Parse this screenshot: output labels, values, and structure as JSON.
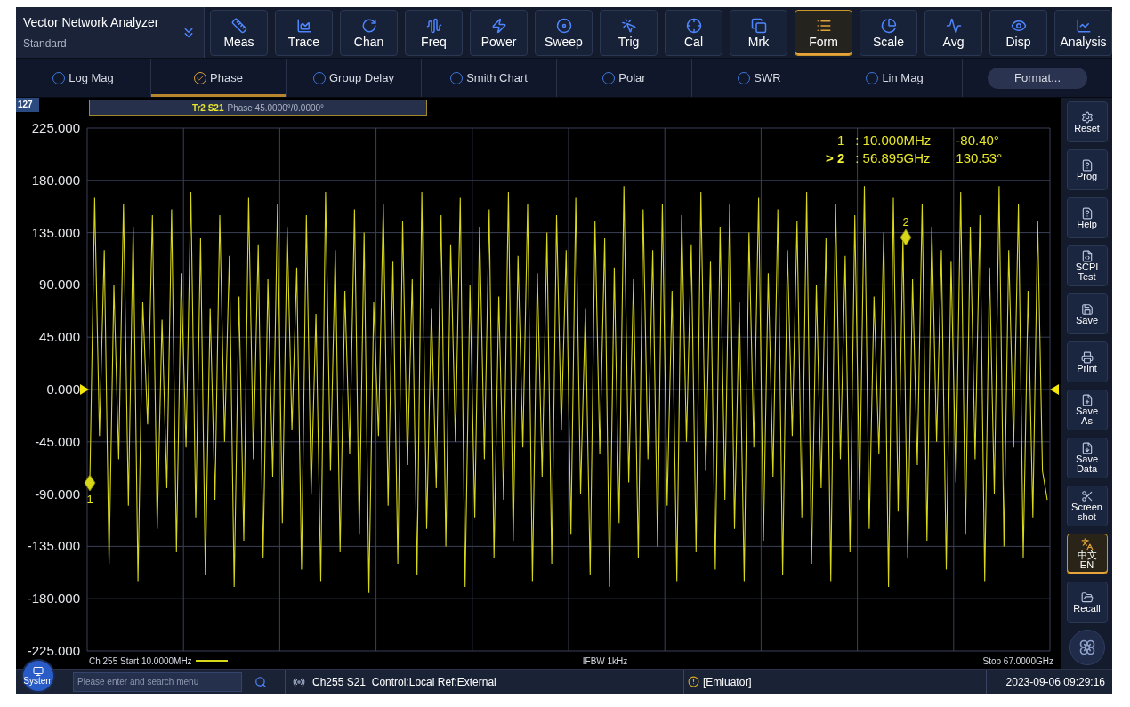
{
  "app": {
    "title": "Vector Network Analyzer",
    "subtitle": "Standard"
  },
  "toolbar": [
    {
      "label": "Meas",
      "selected": false
    },
    {
      "label": "Trace",
      "selected": false
    },
    {
      "label": "Chan",
      "selected": false
    },
    {
      "label": "Freq",
      "selected": false
    },
    {
      "label": "Power",
      "selected": false
    },
    {
      "label": "Sweep",
      "selected": false
    },
    {
      "label": "Trig",
      "selected": false
    },
    {
      "label": "Cal",
      "selected": false
    },
    {
      "label": "Mrk",
      "selected": false
    },
    {
      "label": "Form",
      "selected": true
    },
    {
      "label": "Scale",
      "selected": false
    },
    {
      "label": "Avg",
      "selected": false
    },
    {
      "label": "Disp",
      "selected": false
    },
    {
      "label": "Analysis",
      "selected": false
    }
  ],
  "formats": [
    {
      "label": "Log Mag",
      "selected": false
    },
    {
      "label": "Phase",
      "selected": true
    },
    {
      "label": "Group Delay",
      "selected": false
    },
    {
      "label": "Smith Chart",
      "selected": false
    },
    {
      "label": "Polar",
      "selected": false
    },
    {
      "label": "SWR",
      "selected": false
    },
    {
      "label": "Lin Mag",
      "selected": false
    }
  ],
  "format_button": "Format...",
  "chart": {
    "corner_badge": "127",
    "trace_title": {
      "text": "Phase 45.0000°/0.0000°"
    },
    "chart_data": {
      "type": "line",
      "grid": true,
      "ylim": [
        -225,
        225
      ],
      "yticks": [
        {
          "value": 225,
          "label": "225.000"
        },
        {
          "value": 180,
          "label": "180.000"
        },
        {
          "value": 135,
          "label": "135.000"
        },
        {
          "value": 90,
          "label": "90.000"
        },
        {
          "value": 45,
          "label": "45.000"
        },
        {
          "value": 0,
          "label": "0.000"
        },
        {
          "value": -45,
          "label": "-45.000"
        },
        {
          "value": -90,
          "label": "-90.000"
        },
        {
          "value": -135,
          "label": "-135.000"
        },
        {
          "value": -180,
          "label": "-180.000"
        },
        {
          "value": -225,
          "label": "-225.000"
        }
      ],
      "series": [
        {
          "name": "Tr2 S21",
          "color": "#d8d81a",
          "values": [
            -80,
            165,
            -40,
            120,
            -150,
            90,
            -60,
            160,
            -100,
            140,
            -165,
            75,
            -30,
            150,
            -120,
            60,
            -85,
            155,
            -140,
            100,
            -50,
            170,
            -110,
            130,
            -160,
            70,
            -95,
            150,
            -45,
            115,
            -170,
            80,
            -130,
            165,
            -60,
            125,
            -145,
            95,
            -75,
            160,
            -115,
            140,
            -35,
            105,
            -155,
            150,
            -90,
            65,
            -165,
            170,
            -70,
            120,
            -140,
            85,
            -55,
            155,
            -125,
            135,
            -175,
            75,
            -40,
            160,
            -100,
            110,
            -150,
            145,
            -65,
            95,
            -160,
            170,
            -120,
            70,
            -85,
            150,
            -135,
            125,
            -45,
            165,
            -170,
            90,
            -110,
            140,
            -60,
            155,
            -145,
            80,
            -95,
            170,
            -130,
            115,
            -50,
            160,
            -165,
            100,
            -75,
            135,
            -150,
            150,
            -35,
            120,
            -125,
            165,
            -90,
            70,
            -160,
            145,
            -55,
            130,
            -170,
            105,
            -115,
            175,
            -80,
            95,
            -145,
            155,
            -60,
            120,
            -135,
            160,
            -100,
            85,
            -165,
            150,
            -45,
            125,
            -140,
            170,
            -70,
            110,
            -155,
            140,
            -95,
            160,
            -120,
            75,
            -165,
            135,
            -50,
            165,
            -130,
            100,
            -75,
            155,
            -160,
            120,
            -40,
            145,
            -110,
            170,
            -150,
            90,
            -85,
            130,
            -165,
            160,
            -60,
            115,
            -140,
            150,
            -95,
            175,
            -120,
            80,
            -55,
            135,
            -170,
            165,
            -105,
            131,
            -145,
            95,
            -65,
            160,
            -130,
            140,
            -45,
            120,
            -155,
            110,
            -80,
            170,
            -125,
            140,
            -60,
            150,
            -165,
            105,
            -90,
            175,
            -135,
            120,
            -50,
            160,
            -145,
            85,
            -110,
            145,
            -70,
            -95
          ]
        }
      ],
      "annotations": [
        "1",
        "2"
      ]
    },
    "active_marker_symbol": ">",
    "marker_readouts": [
      {
        "label": "1",
        "selected": false,
        "stimulus": ": 10.000MHz",
        "value": "-80.40°"
      },
      {
        "label": "2",
        "selected": true,
        "stimulus": ": 56.895GHz",
        "value": "130.53°"
      }
    ],
    "start": "Ch 255 Start 10.0000MHz",
    "ifbw": "IFBW 1kHz",
    "stop": "Stop 67.0000GHz"
  },
  "sidebar": [
    {
      "lines": [
        "Reset"
      ],
      "selected": false
    },
    {
      "lines": [
        "Prog"
      ],
      "selected": false
    },
    {
      "lines": [
        "Help"
      ],
      "selected": false
    },
    {
      "lines": [
        "SCPI",
        "Test"
      ],
      "selected": false
    },
    {
      "lines": [
        "Save"
      ],
      "selected": false
    },
    {
      "lines": [
        "Print"
      ],
      "selected": false
    },
    {
      "lines": [
        "Save",
        "As"
      ],
      "selected": false
    },
    {
      "lines": [
        "Save",
        "Data"
      ],
      "selected": false
    },
    {
      "lines": [
        "Screen",
        "shot"
      ],
      "selected": false
    },
    {
      "lines": [
        "中文",
        "EN"
      ],
      "selected": true
    },
    {
      "lines": [
        "Recall"
      ],
      "selected": false
    }
  ],
  "status_bar": {
    "system": "System",
    "search": {
      "placeholder": "Please enter and search menu"
    },
    "channel": "Ch255 S21  Control:Local Ref:External",
    "device": "[Emluator]",
    "time": "2023-09-06 09:29:16"
  }
}
